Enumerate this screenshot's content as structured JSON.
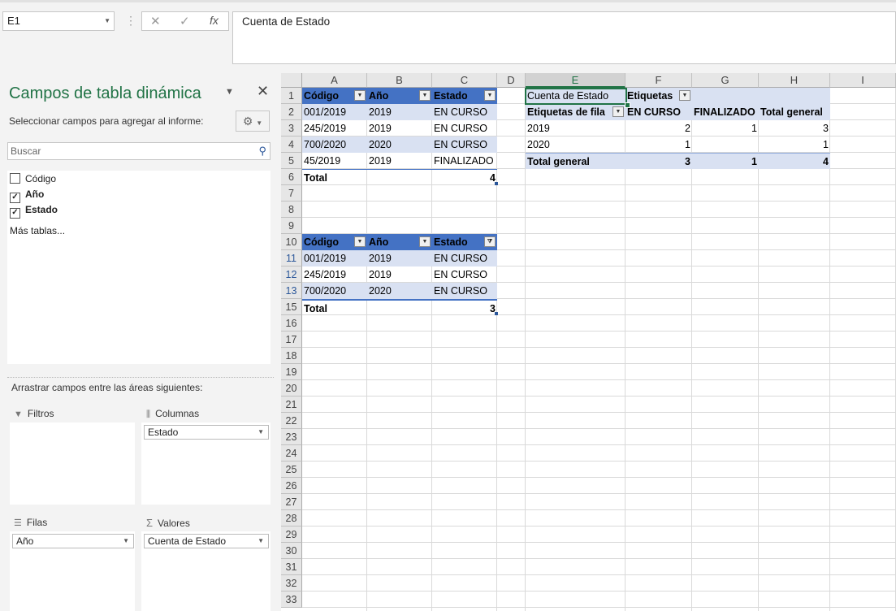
{
  "formula_bar": {
    "name_box": "E1",
    "formula": "Cuenta de Estado"
  },
  "pane": {
    "title": "Campos de tabla dinámica",
    "subtitle": "Seleccionar campos para agregar al informe:",
    "search_placeholder": "Buscar",
    "fields": [
      {
        "label": "Código",
        "checked": false
      },
      {
        "label": "Año",
        "checked": true
      },
      {
        "label": "Estado",
        "checked": true
      }
    ],
    "more_tables": "Más tablas...",
    "drag_label": "Arrastrar campos entre las áreas siguientes:",
    "areas": {
      "filters": {
        "label": "Filtros",
        "fields": []
      },
      "columns": {
        "label": "Columnas",
        "fields": [
          "Estado"
        ]
      },
      "rows": {
        "label": "Filas",
        "fields": [
          "Año"
        ]
      },
      "values": {
        "label": "Valores",
        "fields": [
          "Cuenta de Estado"
        ]
      }
    }
  },
  "sheet": {
    "columns": [
      "A",
      "B",
      "C",
      "D",
      "E",
      "F",
      "G",
      "H",
      "I"
    ],
    "selected_column": "E",
    "rows": [
      "1",
      "2",
      "3",
      "4",
      "5",
      "6",
      "7",
      "8",
      "9",
      "10",
      "11",
      "12",
      "13",
      "15",
      "16",
      "17",
      "18",
      "19",
      "20",
      "21",
      "22",
      "23",
      "24",
      "25",
      "26",
      "27",
      "28",
      "29",
      "30",
      "31",
      "32",
      "33"
    ],
    "table1": {
      "headers": [
        "Código",
        "Año",
        "Estado"
      ],
      "rows": [
        [
          "001/2019",
          "2019",
          "EN CURSO"
        ],
        [
          "245/2019",
          "2019",
          "EN CURSO"
        ],
        [
          "700/2020",
          "2020",
          "EN CURSO"
        ],
        [
          "45/2019",
          "2019",
          "FINALIZADO"
        ]
      ],
      "total_label": "Total",
      "total_value": "4"
    },
    "table2": {
      "headers": [
        "Código",
        "Año",
        "Estado"
      ],
      "rows": [
        [
          "001/2019",
          "2019",
          "EN CURSO"
        ],
        [
          "245/2019",
          "2019",
          "EN CURSO"
        ],
        [
          "700/2020",
          "2020",
          "EN CURSO"
        ]
      ],
      "total_label": "Total",
      "total_value": "3"
    },
    "pivot": {
      "value_label": "Cuenta de Estado",
      "col_labels": "Etiquetas",
      "row_labels": "Etiquetas de fila",
      "col_headers": [
        "EN CURSO",
        "FINALIZADO",
        "Total general"
      ],
      "rows": [
        [
          "2019",
          "2",
          "1",
          "3"
        ],
        [
          "2020",
          "1",
          "",
          "1"
        ]
      ],
      "grand_total": [
        "Total general",
        "3",
        "1",
        "4"
      ]
    }
  }
}
